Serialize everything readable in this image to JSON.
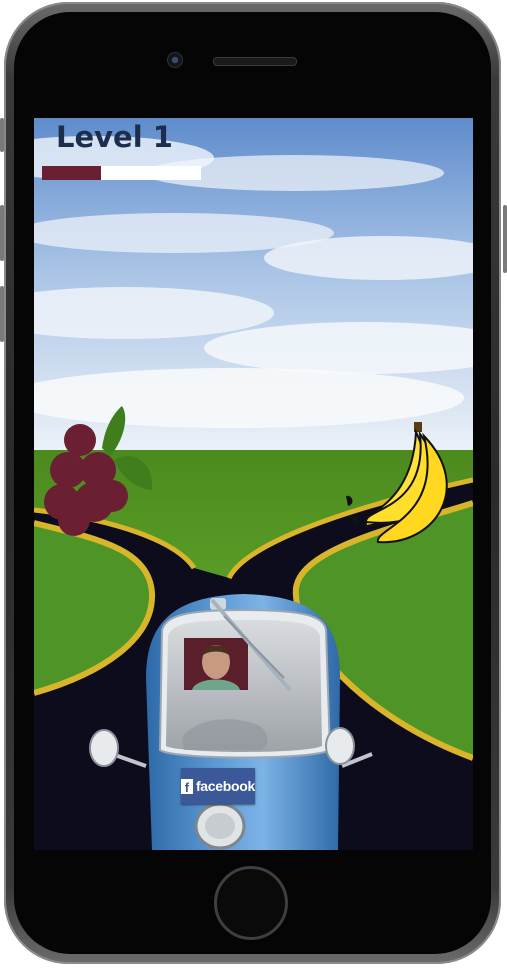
{
  "game": {
    "level_label": "Level 1",
    "progress_fraction": 0.37,
    "progress_fill_color": "#6b1f33",
    "progress_track_color": "#ffffff"
  },
  "scene": {
    "obstacles": [
      {
        "kind": "grapes",
        "icon": "grapes-icon",
        "lane": "left",
        "color": "#6b1f33"
      },
      {
        "kind": "banana",
        "icon": "banana-icon",
        "lane": "right",
        "color": "#ffe23a"
      }
    ],
    "player": {
      "vehicle": "blue-microcar",
      "color": "#4f86c3"
    }
  },
  "car": {
    "badge": {
      "icon": "facebook-f-icon",
      "glyph": "f",
      "label": "facebook",
      "color": "#3b5998"
    }
  }
}
